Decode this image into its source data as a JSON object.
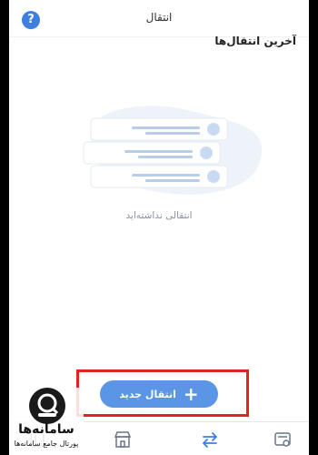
{
  "header": {
    "title": "انتقال",
    "help_label": "?"
  },
  "section": {
    "title": "آخرین انتقال‌ها"
  },
  "empty_state": {
    "message": "انتقالی نداشته‌اید"
  },
  "actions": {
    "new_transfer_label": "انتقال جدید",
    "plus_symbol": "+"
  },
  "bottom_nav": {
    "items": [
      {
        "icon": "cards-icon"
      },
      {
        "icon": "store-icon"
      },
      {
        "icon": "transfer-arrows-icon"
      },
      {
        "icon": "transactions-icon"
      }
    ]
  },
  "watermark": {
    "name": "سامانه‌ها",
    "subtitle": "پورتال جامع سامانه‌ها"
  },
  "colors": {
    "accent": "#3f7fe0",
    "button": "#5b95e6",
    "highlight_border": "#e02424",
    "muted_text": "#8a93a3"
  }
}
